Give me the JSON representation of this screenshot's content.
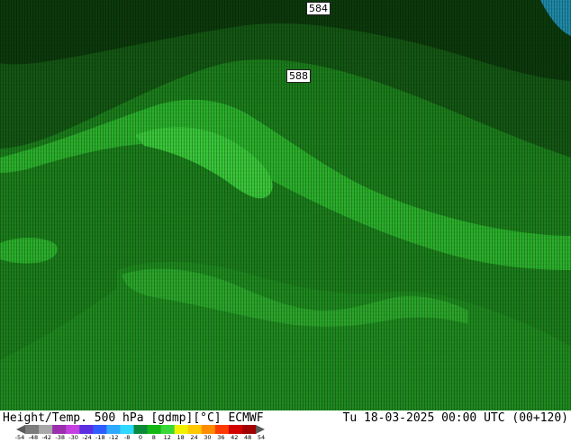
{
  "map": {
    "contour_labels": [
      "584",
      "588"
    ],
    "fill_colors": {
      "deep": "#0c3a0c",
      "dark": "#145714",
      "mid": "#1c7e1c",
      "light": "#2bb02b",
      "bright": "#39c839",
      "edge_blue": "#1f8aa8"
    }
  },
  "footer": {
    "title": "Height/Temp. 500 hPa [gdmp][°C] ECMWF",
    "time": "Tu 18-03-2025 00:00 UTC (00+120)"
  },
  "colorbar": {
    "ticks": [
      "-54",
      "-48",
      "-42",
      "-38",
      "-30",
      "-24",
      "-18",
      "-12",
      "-8",
      "0",
      "8",
      "12",
      "18",
      "24",
      "30",
      "36",
      "42",
      "48",
      "54"
    ],
    "colors": [
      "#5a5a5a",
      "#7c7c7c",
      "#a8a8a8",
      "#9b2fae",
      "#c63fe0",
      "#5b2fe0",
      "#2f5cff",
      "#2fa8ff",
      "#2fd8ff",
      "#0b8a3c",
      "#14b814",
      "#37d837",
      "#f0f000",
      "#ffc800",
      "#ff8c00",
      "#ff3c00",
      "#d40000",
      "#a00000",
      "#5a5a5a"
    ]
  }
}
